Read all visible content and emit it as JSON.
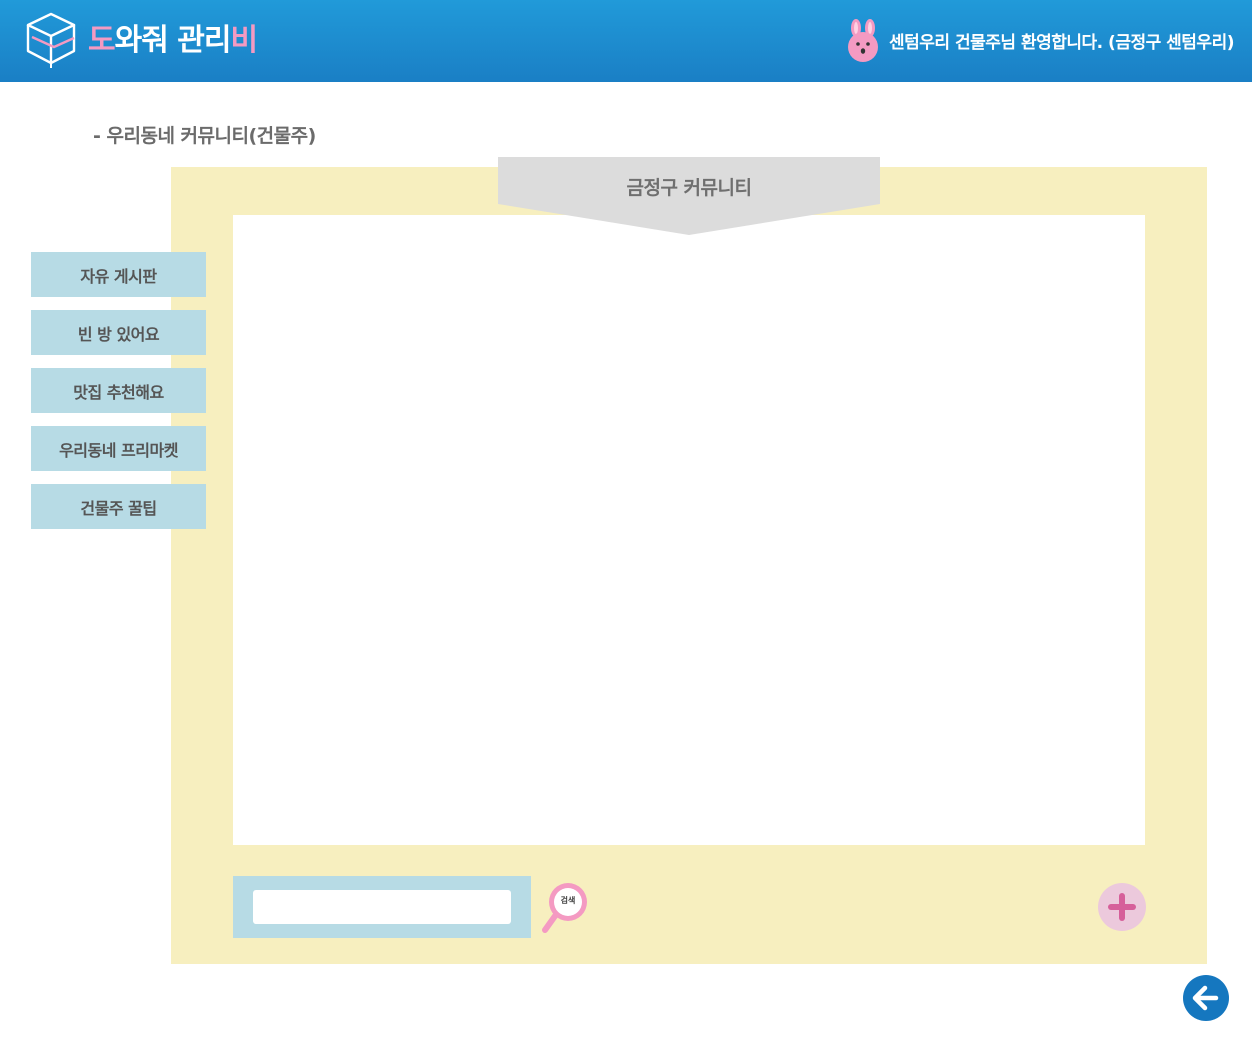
{
  "header": {
    "logo": {
      "part1": "도",
      "part2": "와줘 관리",
      "part3": "비"
    },
    "welcome_text": "센텀우리 건물주님 환영합니다. (금정구 센텀우리)",
    "mascot_icon": "bunny-icon"
  },
  "page": {
    "title": "- 우리동네 커뮤니티(건물주)"
  },
  "community": {
    "banner_title": "금정구 커뮤니티"
  },
  "sidebar": {
    "items": [
      {
        "label": "자유 게시판"
      },
      {
        "label": "빈 방 있어요"
      },
      {
        "label": "맛집 추천해요"
      },
      {
        "label": "우리동네 프리마켓"
      },
      {
        "label": "건물주 꿀팁"
      }
    ]
  },
  "search": {
    "value": "",
    "placeholder": "",
    "button_label": "검색",
    "icon": "magnifier-icon"
  },
  "actions": {
    "add_icon": "plus-icon",
    "back_icon": "arrow-left-icon"
  },
  "colors": {
    "header_blue": "#1a8fd3",
    "panel_yellow": "#f7efbf",
    "menu_blue": "#b7dbe5",
    "accent_pink": "#f49ac2",
    "back_blue": "#1577bf"
  }
}
